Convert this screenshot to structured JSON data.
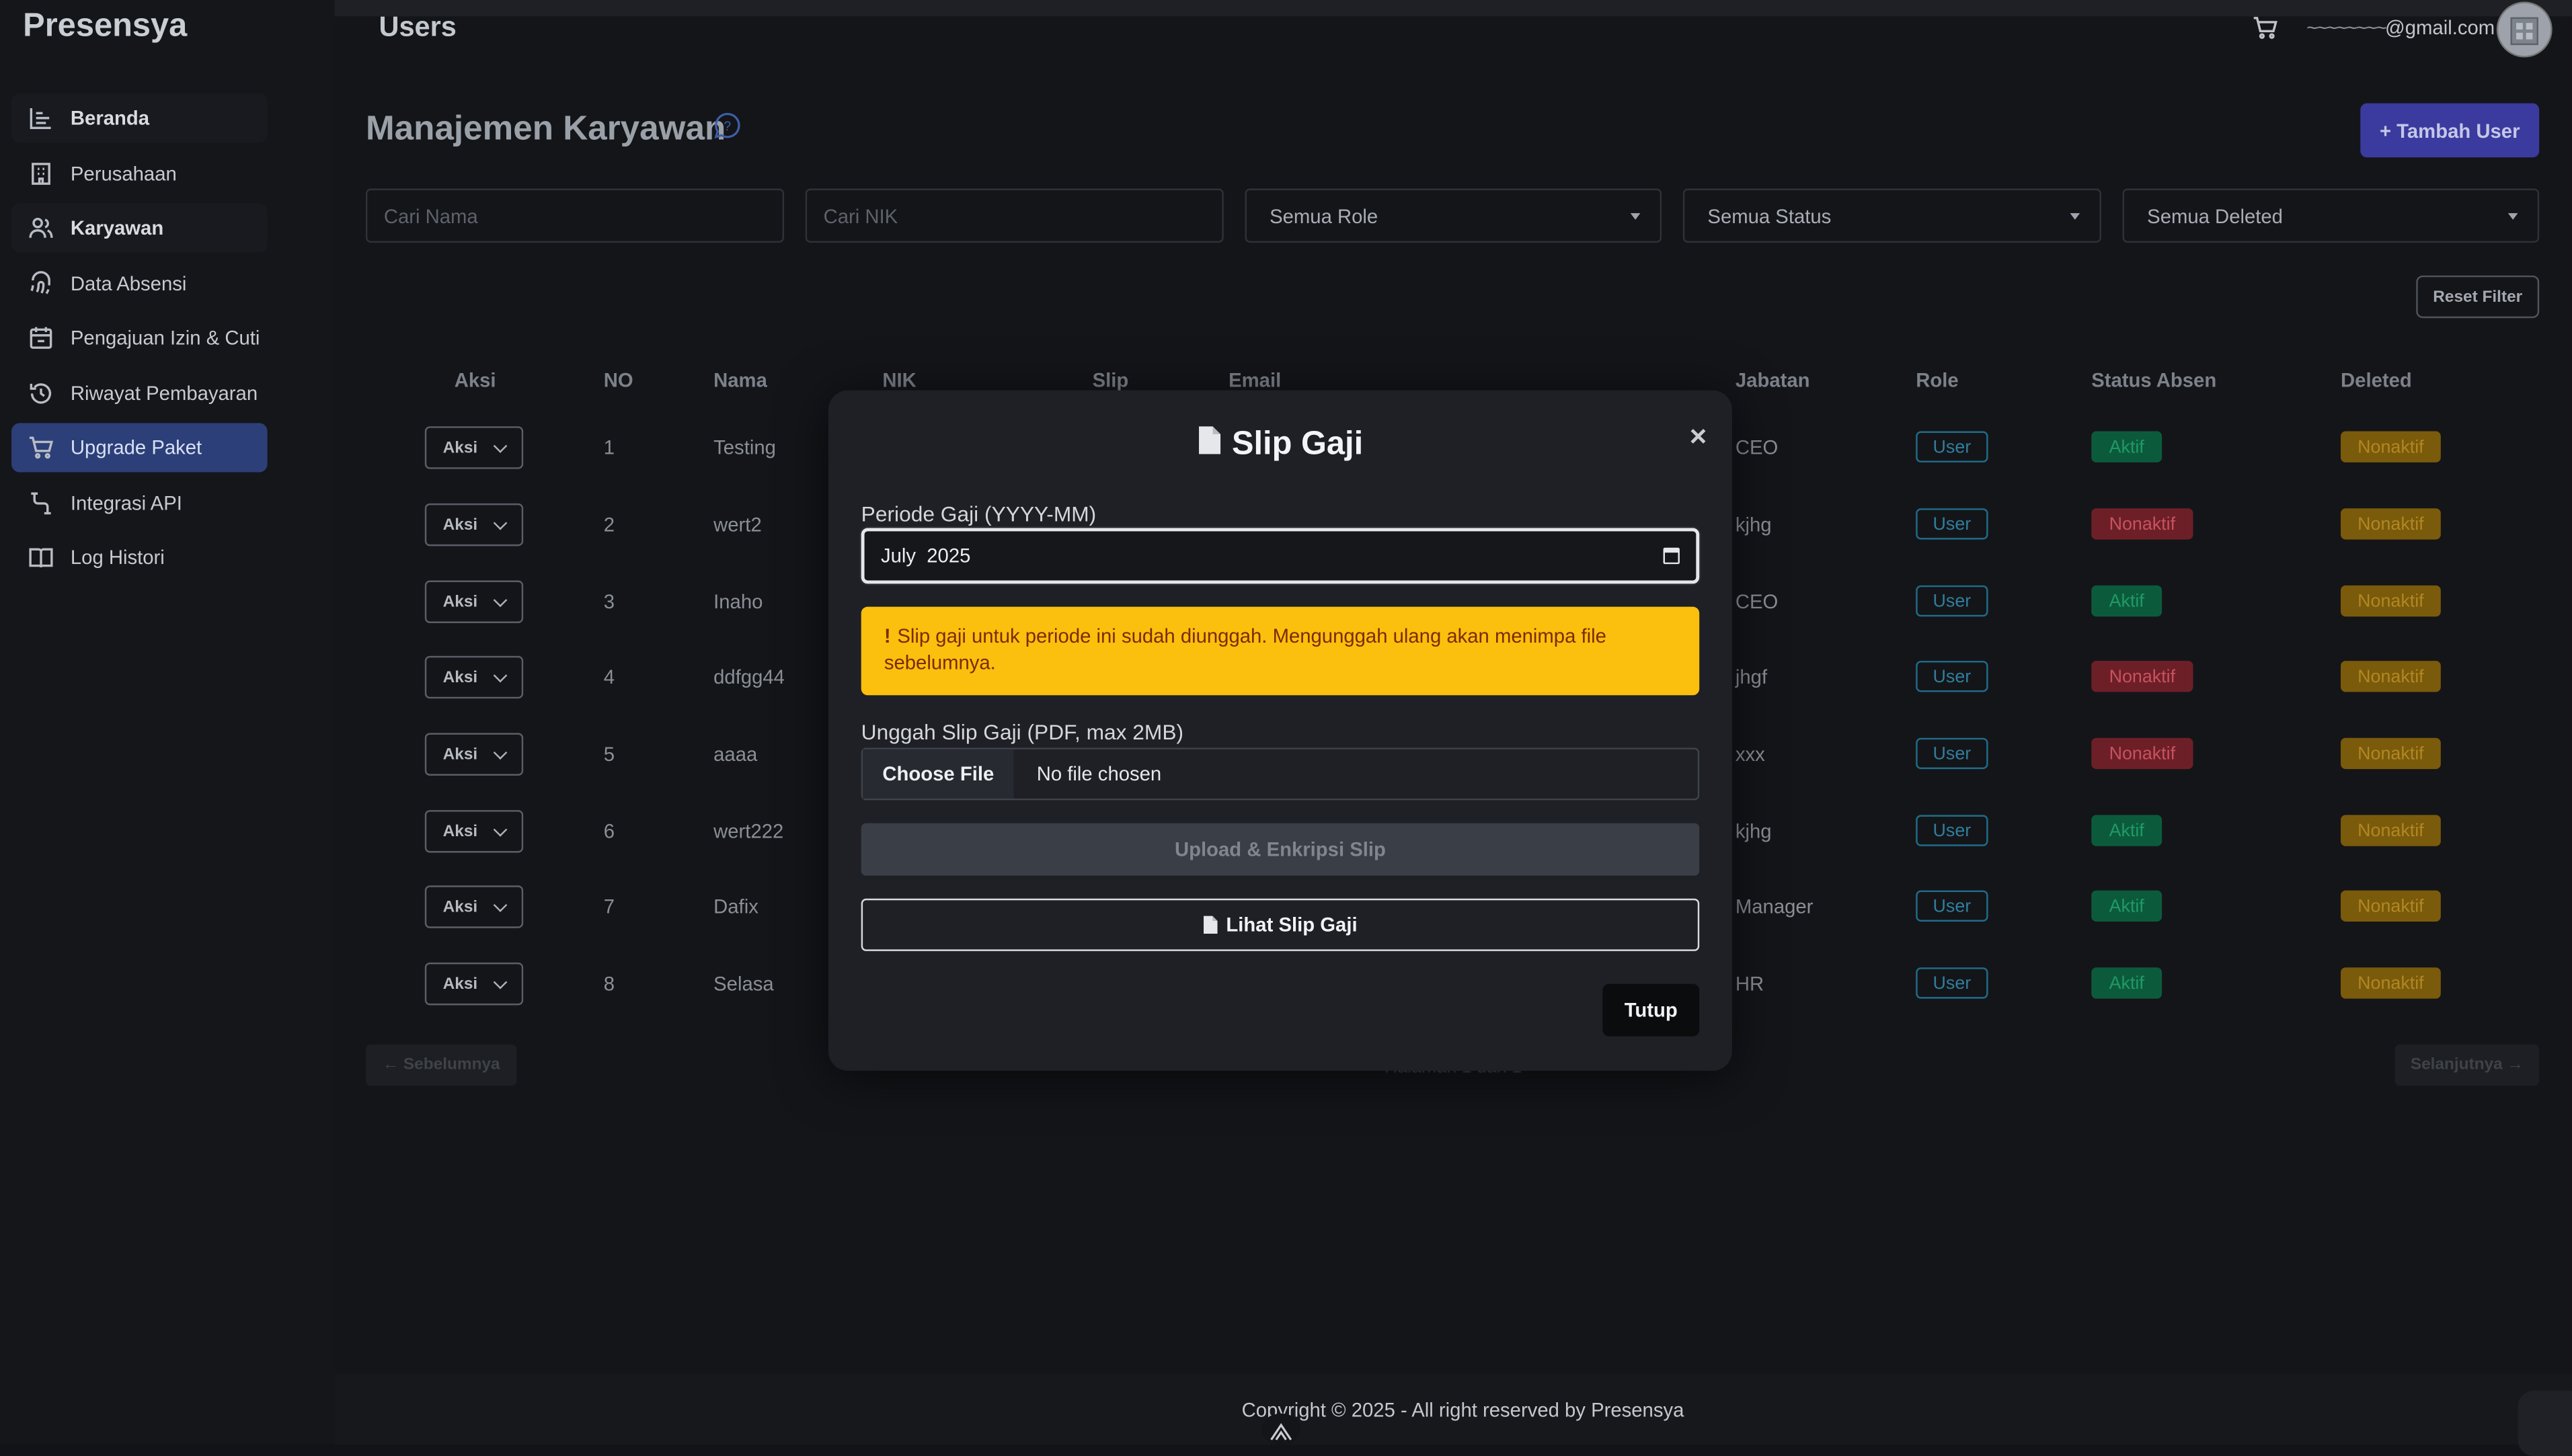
{
  "app": {
    "brand": "Presensya",
    "header_title": "Users",
    "user_email": "@gmail.com"
  },
  "sidebar": {
    "items": [
      {
        "label": "Beranda",
        "icon": "chart-icon"
      },
      {
        "label": "Perusahaan",
        "icon": "building-icon"
      },
      {
        "label": "Karyawan",
        "icon": "users-icon"
      },
      {
        "label": "Data Absensi",
        "icon": "fingerprint-icon"
      },
      {
        "label": "Pengajuan Izin & Cuti",
        "icon": "calendar-icon"
      },
      {
        "label": "Riwayat Pembayaran",
        "icon": "history-icon"
      },
      {
        "label": "Upgrade Paket",
        "icon": "cart-icon"
      },
      {
        "label": "Integrasi API",
        "icon": "api-icon"
      },
      {
        "label": "Log Histori",
        "icon": "book-icon"
      }
    ]
  },
  "page": {
    "title": "Manajemen Karyawan",
    "add_button": "+ Tambah User",
    "reset_filter": "Reset Filter"
  },
  "filters": {
    "search_name_placeholder": "Cari Nama",
    "search_nik_placeholder": "Cari NIK",
    "role": "Semua Role",
    "status": "Semua Status",
    "deleted": "Semua Deleted"
  },
  "table": {
    "headers": [
      "Aksi",
      "NO",
      "Nama",
      "NIK",
      "Slip",
      "Email",
      "Jabatan",
      "Role",
      "Status Absen",
      "Deleted"
    ],
    "action_label": "Aksi",
    "rows": [
      {
        "no": "1",
        "nama": "Testing",
        "jabatan": "CEO",
        "role": "User",
        "status": "Aktif",
        "deleted": "Nonaktif"
      },
      {
        "no": "2",
        "nama": "wert2",
        "jabatan": "kjhg",
        "role": "User",
        "status": "Nonaktif",
        "deleted": "Nonaktif"
      },
      {
        "no": "3",
        "nama": "Inaho",
        "jabatan": "CEO",
        "role": "User",
        "status": "Aktif",
        "deleted": "Nonaktif"
      },
      {
        "no": "4",
        "nama": "ddfgg44",
        "jabatan": "jhgf",
        "role": "User",
        "status": "Nonaktif",
        "deleted": "Nonaktif"
      },
      {
        "no": "5",
        "nama": "aaaa",
        "jabatan": "xxx",
        "role": "User",
        "status": "Nonaktif",
        "deleted": "Nonaktif"
      },
      {
        "no": "6",
        "nama": "wert222",
        "jabatan": "kjhg",
        "role": "User",
        "status": "Aktif",
        "deleted": "Nonaktif"
      },
      {
        "no": "7",
        "nama": "Dafix",
        "jabatan": "Manager",
        "role": "User",
        "status": "Aktif",
        "deleted": "Nonaktif"
      },
      {
        "no": "8",
        "nama": "Selasa",
        "jabatan": "HR",
        "role": "User",
        "status": "Aktif",
        "deleted": "Nonaktif"
      }
    ]
  },
  "pagination": {
    "prev": "← Sebelumnya",
    "next": "Selanjutnya →",
    "info": "Halaman 1 dari 1"
  },
  "footer": {
    "text": "Copyright © 2025 - All right reserved by Presensya"
  },
  "modal": {
    "title": "Slip Gaji",
    "period_label": "Periode Gaji (YYYY-MM)",
    "period_value": "July  2025",
    "warning_icon": "!",
    "warning": "Slip gaji untuk periode ini sudah diunggah. Mengunggah ulang akan menimpa file sebelumnya.",
    "upload_label": "Unggah Slip Gaji (PDF, max 2MB)",
    "choose_file": "Choose File",
    "no_file": "No file chosen",
    "upload_button": "Upload & Enkripsi Slip",
    "view_button": "Lihat Slip Gaji",
    "close_button": "Tutup",
    "close_x": "×"
  },
  "colors": {
    "active_nav": "#2c3f78",
    "primary_button": "#3b3a9f",
    "warning_bg": "#fbbf0d",
    "badge_aktif": "#0c5a3c",
    "badge_nonaktif": "#6d1f28",
    "badge_deleted": "#7a5a0b"
  }
}
